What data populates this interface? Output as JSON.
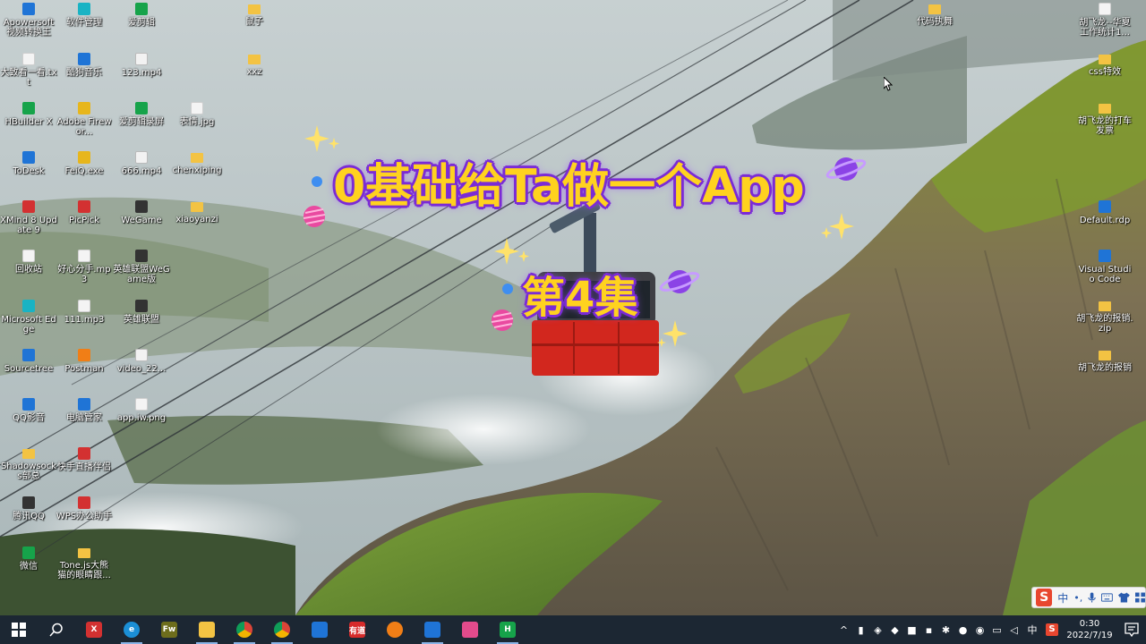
{
  "overlay": {
    "title": "0基础给Ta做一个App",
    "episode": "第4集"
  },
  "desktop_icons": [
    {
      "label": "Apowersoft 视频转换王",
      "icon": "apowersoft-icon",
      "color": "blue",
      "col": 0,
      "row": 0
    },
    {
      "label": "大致看一看.txt",
      "icon": "text-file-icon",
      "color": "file",
      "col": 0,
      "row": 1
    },
    {
      "label": "HBuilder X",
      "icon": "hbuilder-icon",
      "color": "green",
      "col": 0,
      "row": 2
    },
    {
      "label": "ToDesk",
      "icon": "todesk-icon",
      "color": "blue",
      "col": 0,
      "row": 3
    },
    {
      "label": "XMind 8 Update 9",
      "icon": "xmind-icon",
      "color": "red",
      "col": 0,
      "row": 4
    },
    {
      "label": "回收站",
      "icon": "recycle-bin-icon",
      "color": "file",
      "col": 0,
      "row": 5
    },
    {
      "label": "Microsoft Edge",
      "icon": "edge-icon",
      "color": "teal",
      "col": 0,
      "row": 6
    },
    {
      "label": "Sourcetree",
      "icon": "sourcetree-icon",
      "color": "blue",
      "col": 0,
      "row": 7
    },
    {
      "label": "QQ影音",
      "icon": "qq-player-icon",
      "color": "blue",
      "col": 0,
      "row": 8
    },
    {
      "label": "Shadowsocks部总",
      "icon": "folder-icon",
      "color": "folder",
      "col": 0,
      "row": 9
    },
    {
      "label": "腾讯QQ",
      "icon": "qq-icon",
      "color": "dark",
      "col": 0,
      "row": 10
    },
    {
      "label": "微信",
      "icon": "wechat-icon",
      "color": "green",
      "col": 0,
      "row": 11
    },
    {
      "label": "软件管理",
      "icon": "software-manager-icon",
      "color": "teal",
      "col": 1,
      "row": 0
    },
    {
      "label": "酷狗音乐",
      "icon": "kugou-icon",
      "color": "blue",
      "col": 1,
      "row": 1
    },
    {
      "label": "Adobe Firewor...",
      "icon": "fireworks-icon",
      "color": "yellow",
      "col": 1,
      "row": 2
    },
    {
      "label": "FeiQ.exe",
      "icon": "feiq-icon",
      "color": "yellow",
      "col": 1,
      "row": 3
    },
    {
      "label": "PicPick",
      "icon": "picpick-icon",
      "color": "red",
      "col": 1,
      "row": 4
    },
    {
      "label": "好心分手.mp3",
      "icon": "audio-file-icon",
      "color": "file",
      "col": 1,
      "row": 5
    },
    {
      "label": "111.mp3",
      "icon": "audio-file-icon",
      "color": "file",
      "col": 1,
      "row": 6
    },
    {
      "label": "Postman",
      "icon": "postman-icon",
      "color": "orange",
      "col": 1,
      "row": 7
    },
    {
      "label": "电脑管家",
      "icon": "pc-manager-icon",
      "color": "blue",
      "col": 1,
      "row": 8
    },
    {
      "label": "快手直播伴侣",
      "icon": "kuaishou-icon",
      "color": "red",
      "col": 1,
      "row": 9
    },
    {
      "label": "WPS办公助手",
      "icon": "wps-icon",
      "color": "red",
      "col": 1,
      "row": 10
    },
    {
      "label": "Tone.js大熊猫的眼睛跟...",
      "icon": "folder-icon",
      "color": "folder",
      "col": 1,
      "row": 11
    },
    {
      "label": "爱剪辑",
      "icon": "aijianji-icon",
      "color": "green",
      "col": 2,
      "row": 0
    },
    {
      "label": "123.mp4",
      "icon": "video-file-icon",
      "color": "vid",
      "col": 2,
      "row": 1
    },
    {
      "label": "爱剪辑录屏",
      "icon": "aijianji-record-icon",
      "color": "green",
      "col": 2,
      "row": 2
    },
    {
      "label": "666.mp4",
      "icon": "video-file-icon",
      "color": "vid",
      "col": 2,
      "row": 3
    },
    {
      "label": "WeGame",
      "icon": "wegame-icon",
      "color": "dark",
      "col": 2,
      "row": 4
    },
    {
      "label": "英雄联盟WeGame版",
      "icon": "lol-wegame-icon",
      "color": "dark",
      "col": 2,
      "row": 5
    },
    {
      "label": "英雄联盟",
      "icon": "lol-icon",
      "color": "dark",
      "col": 2,
      "row": 6
    },
    {
      "label": "video_22...",
      "icon": "video-file-icon",
      "color": "vid",
      "col": 2,
      "row": 7
    },
    {
      "label": "app.iw.png",
      "icon": "image-file-icon",
      "color": "file",
      "col": 2,
      "row": 8
    },
    {
      "label": "表情.jpg",
      "icon": "image-file-icon",
      "color": "file",
      "col": 3,
      "row": 2
    },
    {
      "label": "chenxiping",
      "icon": "folder-icon",
      "color": "folder",
      "col": 3,
      "row": 3
    },
    {
      "label": "xiaoyanzi",
      "icon": "folder-icon",
      "color": "folder",
      "col": 3,
      "row": 4
    },
    {
      "label": "鼠子",
      "icon": "folder-icon",
      "color": "folder",
      "col": 4,
      "row": 0
    },
    {
      "label": "xxz",
      "icon": "folder-icon",
      "color": "folder",
      "col": 4,
      "row": 1
    },
    {
      "label": "代码执舞",
      "icon": "folder-icon",
      "color": "folder",
      "col": 5,
      "row": 0
    },
    {
      "label": "胡飞龙--华夏工作统计1...",
      "icon": "document-file-icon",
      "color": "file",
      "col": 6,
      "row": 0
    },
    {
      "label": "css特效",
      "icon": "folder-icon",
      "color": "folder",
      "col": 6,
      "row": 1
    },
    {
      "label": "胡飞龙的打车发票",
      "icon": "folder-icon",
      "color": "folder",
      "col": 6,
      "row": 2
    },
    {
      "label": "Default.rdp",
      "icon": "rdp-file-icon",
      "color": "blue",
      "col": 6,
      "row": 4
    },
    {
      "label": "Visual Studio Code",
      "icon": "vscode-icon",
      "color": "blue",
      "col": 6,
      "row": 5
    },
    {
      "label": "胡飞龙的报销.zip",
      "icon": "zip-file-icon",
      "color": "folder",
      "col": 6,
      "row": 6
    },
    {
      "label": "胡飞龙的报销",
      "icon": "folder-icon",
      "color": "folder",
      "col": 6,
      "row": 7
    }
  ],
  "ime": {
    "logo": "S",
    "mode": "中",
    "punct": "•,",
    "mic": "mic-icon",
    "keyboard": "keyboard-icon",
    "skin": "shirt-icon",
    "grid": "grid-icon"
  },
  "taskbar": {
    "apps": [
      {
        "name": "start-button",
        "glyph": "",
        "color": "#1c2733"
      },
      {
        "name": "search-button",
        "glyph": "",
        "color": "#1c2733"
      },
      {
        "name": "xmind-taskbar",
        "glyph": "X",
        "color": "#d33131"
      },
      {
        "name": "edge-taskbar",
        "glyph": "e",
        "color": "#1b8fd6"
      },
      {
        "name": "fireworks-taskbar",
        "glyph": "Fw",
        "color": "#6d6d1c"
      },
      {
        "name": "file-explorer-taskbar",
        "glyph": "",
        "color": "#f3c343"
      },
      {
        "name": "chrome-taskbar",
        "glyph": "",
        "color": "#3aa757"
      },
      {
        "name": "chrome-2-taskbar",
        "glyph": "",
        "color": "#3aa757"
      },
      {
        "name": "maps-taskbar",
        "glyph": "",
        "color": "#1f74d6"
      },
      {
        "name": "youdao-taskbar",
        "glyph": "有道",
        "color": "#d62b2b"
      },
      {
        "name": "firefox-taskbar",
        "glyph": "",
        "color": "#f07e16"
      },
      {
        "name": "vscode-taskbar",
        "glyph": "",
        "color": "#1f74d6"
      },
      {
        "name": "game-taskbar",
        "glyph": "",
        "color": "#e34b8c"
      },
      {
        "name": "hbuilder-taskbar",
        "glyph": "H",
        "color": "#16a34a"
      }
    ],
    "tray": [
      "chevron-up-icon",
      "usb-icon",
      "shield-icon",
      "vpn-shield-icon",
      "security-icon",
      "printer-icon",
      "bluetooth-icon",
      "wechat-tray-icon",
      "sogou-tray-icon",
      "network-icon",
      "speaker-icon",
      "ime-tray-icon",
      "sogou-s-icon"
    ],
    "ime_indicator": "中",
    "time": "0:30",
    "date": "2022/7/19"
  }
}
